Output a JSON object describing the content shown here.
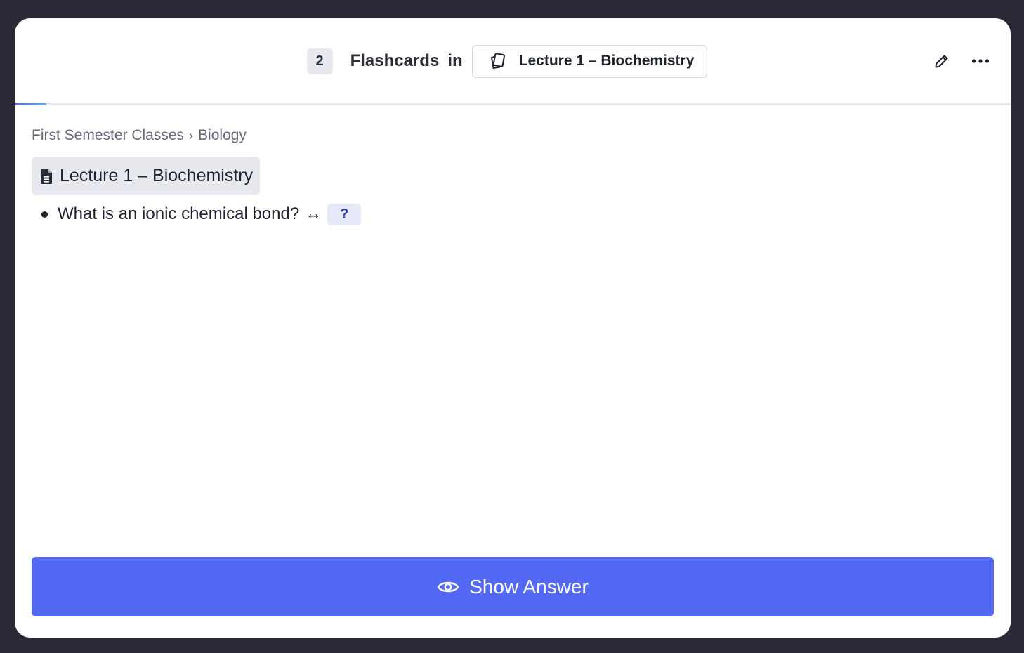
{
  "header": {
    "count": "2",
    "title": "Flashcards",
    "connector": "in",
    "deck_name": "Lecture 1 – Biochemistry",
    "deck_icon": "cards-icon",
    "actions": [
      {
        "name": "edit",
        "icon": "pencil-icon"
      },
      {
        "name": "more",
        "icon": "more-horizontal-icon"
      }
    ],
    "progress_fraction": 0.032
  },
  "breadcrumb": {
    "items": [
      "First Semester Classes",
      "Biology"
    ],
    "separator": "›"
  },
  "note": {
    "icon": "document-icon",
    "title": "Lecture 1 – Biochemistry"
  },
  "card": {
    "question": "What is an ionic chemical bond?",
    "arrow": "↔",
    "cloze_placeholder": "?"
  },
  "footer": {
    "show_answer_label": "Show Answer",
    "show_answer_icon": "eye-icon"
  },
  "colors": {
    "background": "#2a2a36",
    "accent": "#5469f3",
    "cloze_bg": "#e6e9fa",
    "cloze_text": "#2b3bb2"
  }
}
